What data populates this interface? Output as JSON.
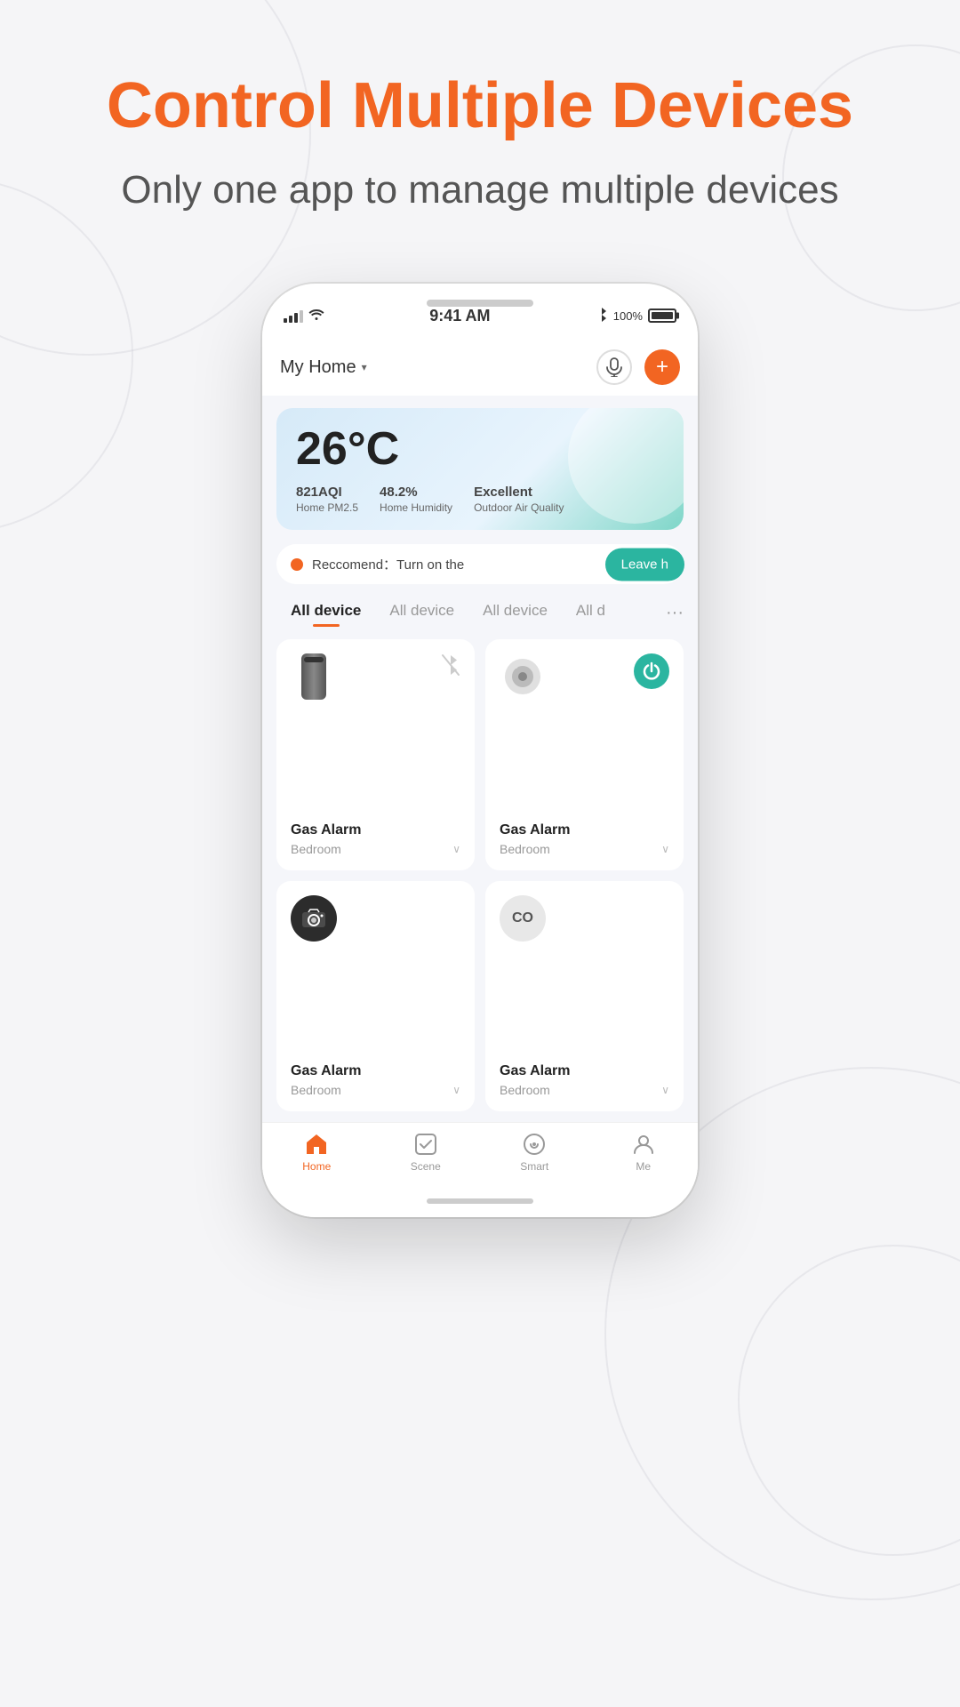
{
  "page": {
    "headline": "Control Multiple Devices",
    "subheadline": "Only one app to manage multiple devices"
  },
  "status_bar": {
    "time": "9:41 AM",
    "battery_percent": "100%",
    "bluetooth": "bluetooth"
  },
  "app_header": {
    "home_name": "My Home",
    "dropdown": "▾",
    "mic_label": "microphone",
    "add_label": "+"
  },
  "weather": {
    "temperature": "26°C",
    "pm25_value": "821AQI",
    "pm25_label": "Home PM2.5",
    "humidity_value": "48.2%",
    "humidity_label": "Home Humidity",
    "air_quality_value": "Excellent",
    "air_quality_label": "Outdoor Air Quality"
  },
  "recommendation": {
    "text": "Reccomend：Turn on the",
    "leave_button": "Leave h"
  },
  "tabs": [
    {
      "label": "All device",
      "active": true
    },
    {
      "label": "All device",
      "active": false
    },
    {
      "label": "All device",
      "active": false
    },
    {
      "label": "All d",
      "active": false
    }
  ],
  "devices": [
    {
      "name": "Gas Alarm",
      "room": "Bedroom",
      "icon_type": "cylinder",
      "has_bluetooth_off": true,
      "has_power": false
    },
    {
      "name": "Gas Alarm",
      "room": "Bedroom",
      "icon_type": "speaker",
      "has_bluetooth_off": false,
      "has_power": true
    },
    {
      "name": "Gas Alarm",
      "room": "Bedroom",
      "icon_type": "camera",
      "has_bluetooth_off": false,
      "has_power": false
    },
    {
      "name": "Gas Alarm",
      "room": "Bedroom",
      "icon_type": "co",
      "has_bluetooth_off": false,
      "has_power": false
    }
  ],
  "nav": {
    "items": [
      {
        "label": "Home",
        "active": true
      },
      {
        "label": "Scene",
        "active": false
      },
      {
        "label": "Smart",
        "active": false
      },
      {
        "label": "Me",
        "active": false
      }
    ]
  }
}
